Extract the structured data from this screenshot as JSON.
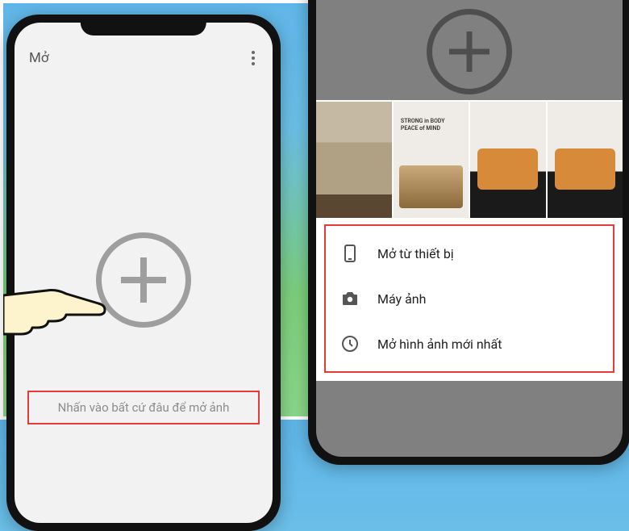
{
  "phone_left": {
    "title": "Mở",
    "hint": "Nhấn vào bất cứ đâu để mở ảnh"
  },
  "menu": {
    "items": [
      {
        "label": "Mở từ thiết bị",
        "icon": "phone-icon"
      },
      {
        "label": "Máy ảnh",
        "icon": "camera-icon"
      },
      {
        "label": "Mở hình ảnh mới nhất",
        "icon": "clock-icon"
      }
    ]
  },
  "colors": {
    "highlight": "#e73a3a"
  },
  "thumb_text": "STRONG in BODY\nPEACE of MIND"
}
